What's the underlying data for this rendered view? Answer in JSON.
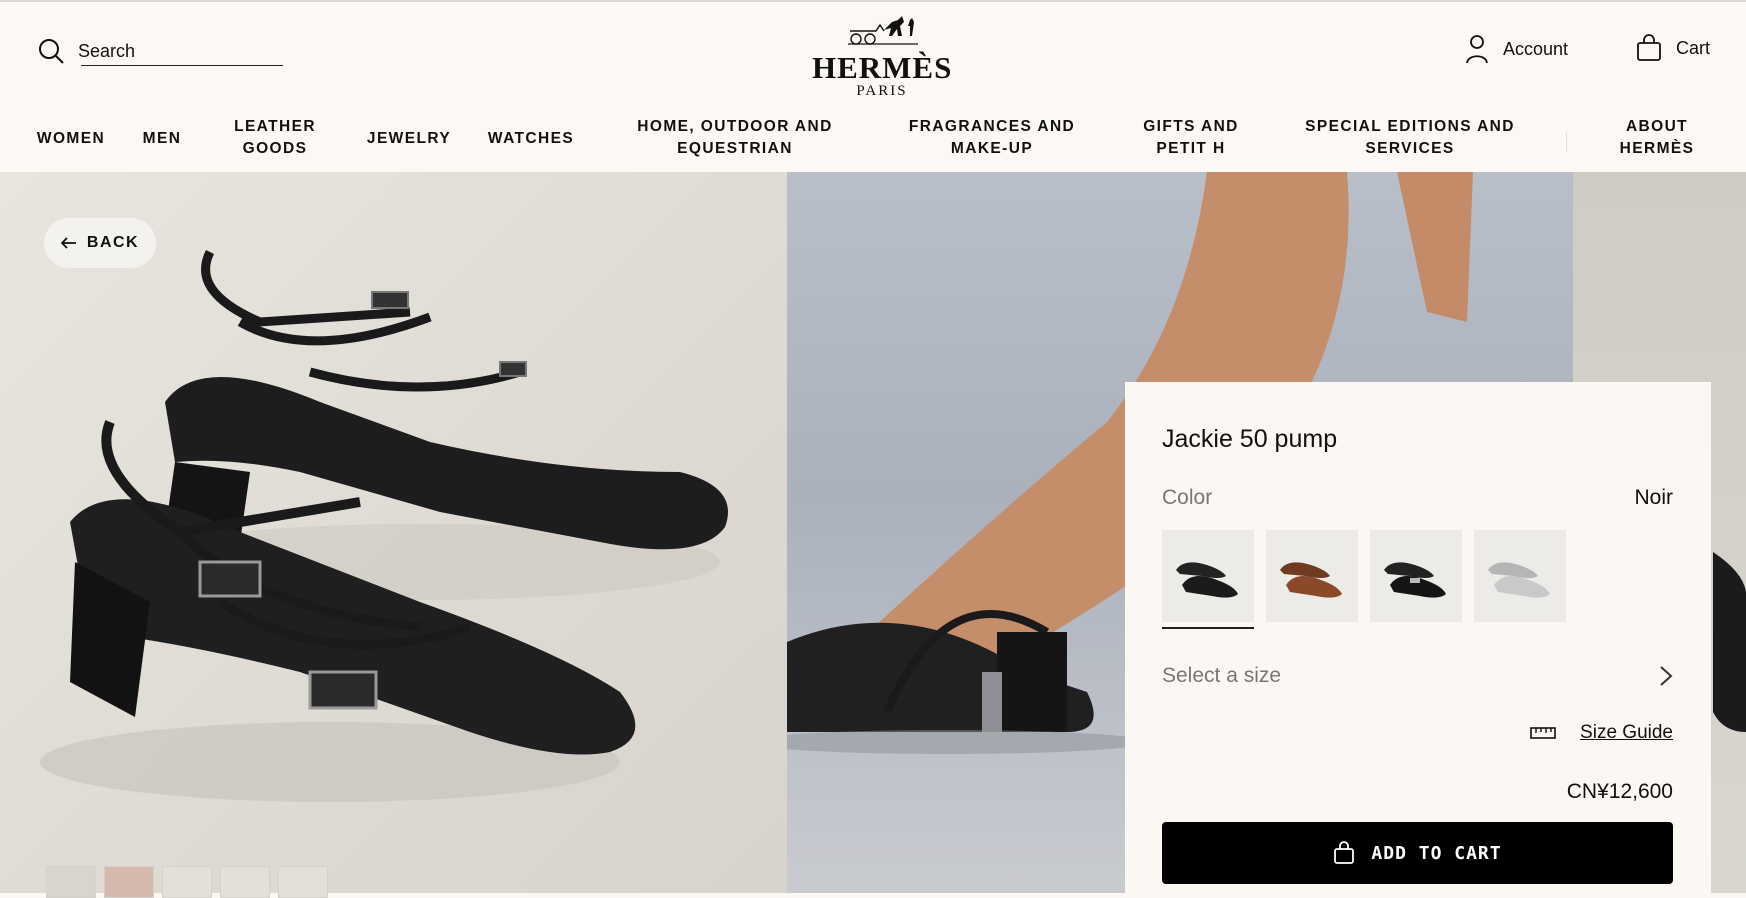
{
  "header": {
    "search_label": "Search",
    "logo_word": "HERMÈS",
    "logo_sub": "PARIS",
    "account_label": "Account",
    "cart_label": "Cart"
  },
  "nav": {
    "items": [
      {
        "label": "WOMEN"
      },
      {
        "label": "MEN"
      },
      {
        "label": "LEATHER\nGOODS"
      },
      {
        "label": "JEWELRY"
      },
      {
        "label": "WATCHES"
      },
      {
        "label": "HOME, OUTDOOR AND\nEQUESTRIAN"
      },
      {
        "label": "FRAGRANCES AND\nMAKE-UP"
      },
      {
        "label": "GIFTS AND\nPETIT H"
      },
      {
        "label": "SPECIAL EDITIONS AND\nSERVICES"
      },
      {
        "label": "ABOUT\nHERMÈS"
      }
    ]
  },
  "hero": {
    "back_label": "BACK"
  },
  "product": {
    "title": "Jackie 50 pump",
    "color_label": "Color",
    "color_value": "Noir",
    "swatches": [
      {
        "name": "noir",
        "tone": "#1b1b1b"
      },
      {
        "name": "brown",
        "tone": "#8a4a2a"
      },
      {
        "name": "black-silver",
        "tone": "#151515"
      },
      {
        "name": "silver",
        "tone": "#c9c9c9"
      }
    ],
    "size_placeholder": "Select a size",
    "size_guide_label": "Size Guide",
    "price": "CN¥12,600",
    "add_to_cart_label": "ADD TO CART"
  },
  "colors": {
    "header_bg": "#fcf8f3",
    "panel_bg": "#fbf8f3",
    "button_bg": "#000000",
    "text": "#111111"
  }
}
